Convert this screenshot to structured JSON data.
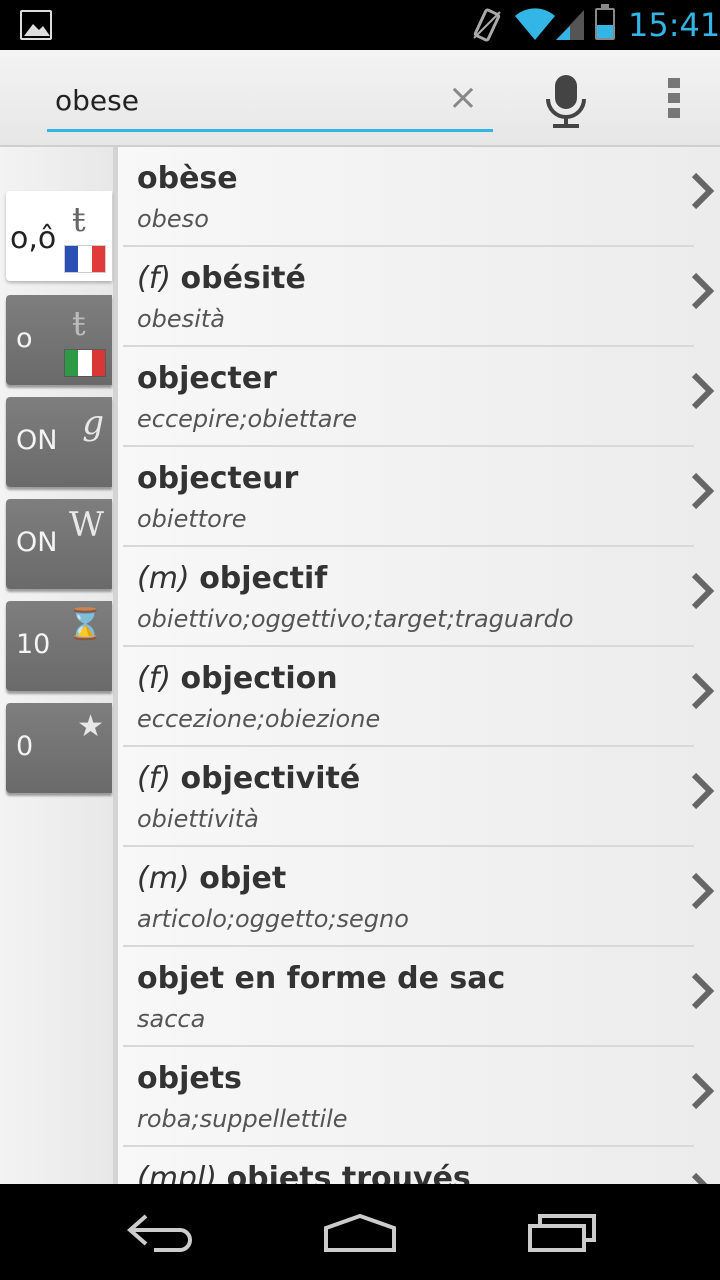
{
  "status_bar": {
    "time": "15:41",
    "icons": [
      "gallery-icon",
      "vibrate-icon",
      "wifi-icon",
      "signal-icon",
      "battery-icon"
    ],
    "accent_color": "#33b5e5"
  },
  "search": {
    "value": "obese",
    "clear_symbol": "×"
  },
  "side_tabs": [
    {
      "label": "o,ô",
      "icon": "dictionary-icon",
      "flag": "fr",
      "active": true
    },
    {
      "label": "o",
      "icon": "dictionary-icon",
      "flag": "it",
      "active": false
    },
    {
      "label": "ON",
      "icon": "google-icon",
      "icon_glyph": "g",
      "active": false
    },
    {
      "label": "ON",
      "icon": "wikipedia-icon",
      "icon_glyph": "W",
      "active": false
    },
    {
      "label": "10",
      "icon": "history-icon",
      "icon_glyph": "⌛",
      "active": false
    },
    {
      "label": "0",
      "icon": "star-icon",
      "icon_glyph": "★",
      "active": false
    }
  ],
  "results": [
    {
      "gender": "",
      "word": "obèse",
      "translation": "obeso"
    },
    {
      "gender": "(f)",
      "word": "obésité",
      "translation": "obesità"
    },
    {
      "gender": "",
      "word": "objecter",
      "translation": "eccepire;obiettare"
    },
    {
      "gender": "",
      "word": "objecteur",
      "translation": "obiettore"
    },
    {
      "gender": "(m)",
      "word": "objectif",
      "translation": "obiettivo;oggettivo;target;traguardo"
    },
    {
      "gender": "(f)",
      "word": "objection",
      "translation": "eccezione;obiezione"
    },
    {
      "gender": "(f)",
      "word": "objectivité",
      "translation": "obiettività"
    },
    {
      "gender": "(m)",
      "word": "objet",
      "translation": "articolo;oggetto;segno"
    },
    {
      "gender": "",
      "word": "objet en forme de sac",
      "translation": "sacca"
    },
    {
      "gender": "",
      "word": "objets",
      "translation": "roba;suppellettile"
    },
    {
      "gender": "(mpl)",
      "word": "objets trouvés",
      "translation": ""
    }
  ],
  "nav_bar": {
    "icons": [
      "back-icon",
      "home-icon",
      "recent-apps-icon"
    ]
  }
}
